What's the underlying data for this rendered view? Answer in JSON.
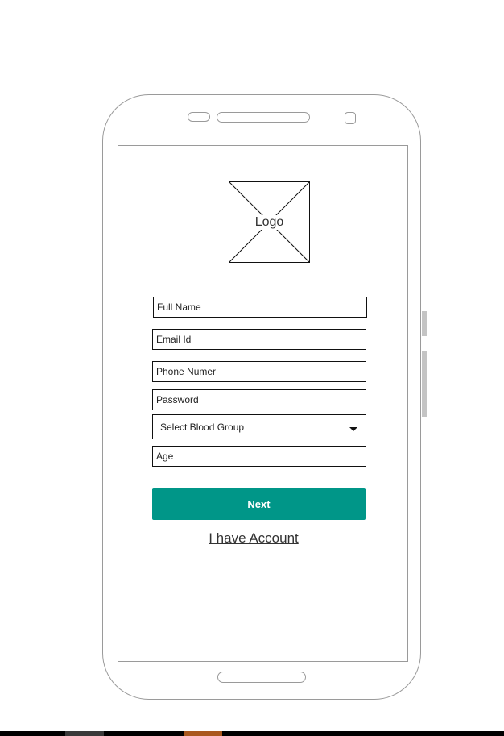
{
  "logo": {
    "label": "Logo"
  },
  "form": {
    "full_name": {
      "placeholder": "Full Name"
    },
    "email": {
      "placeholder": "Email Id"
    },
    "phone": {
      "placeholder": "Phone Numer"
    },
    "password": {
      "placeholder": "Password"
    },
    "blood_group": {
      "selected": "Select Blood Group"
    },
    "age": {
      "placeholder": "Age"
    }
  },
  "actions": {
    "next_label": "Next",
    "account_link": "I have Account"
  },
  "colors": {
    "accent": "#009688",
    "taskbar": "#000000",
    "taskbar_seg_dark": "#3a3a3a",
    "taskbar_seg_orange": "#a9581e"
  }
}
